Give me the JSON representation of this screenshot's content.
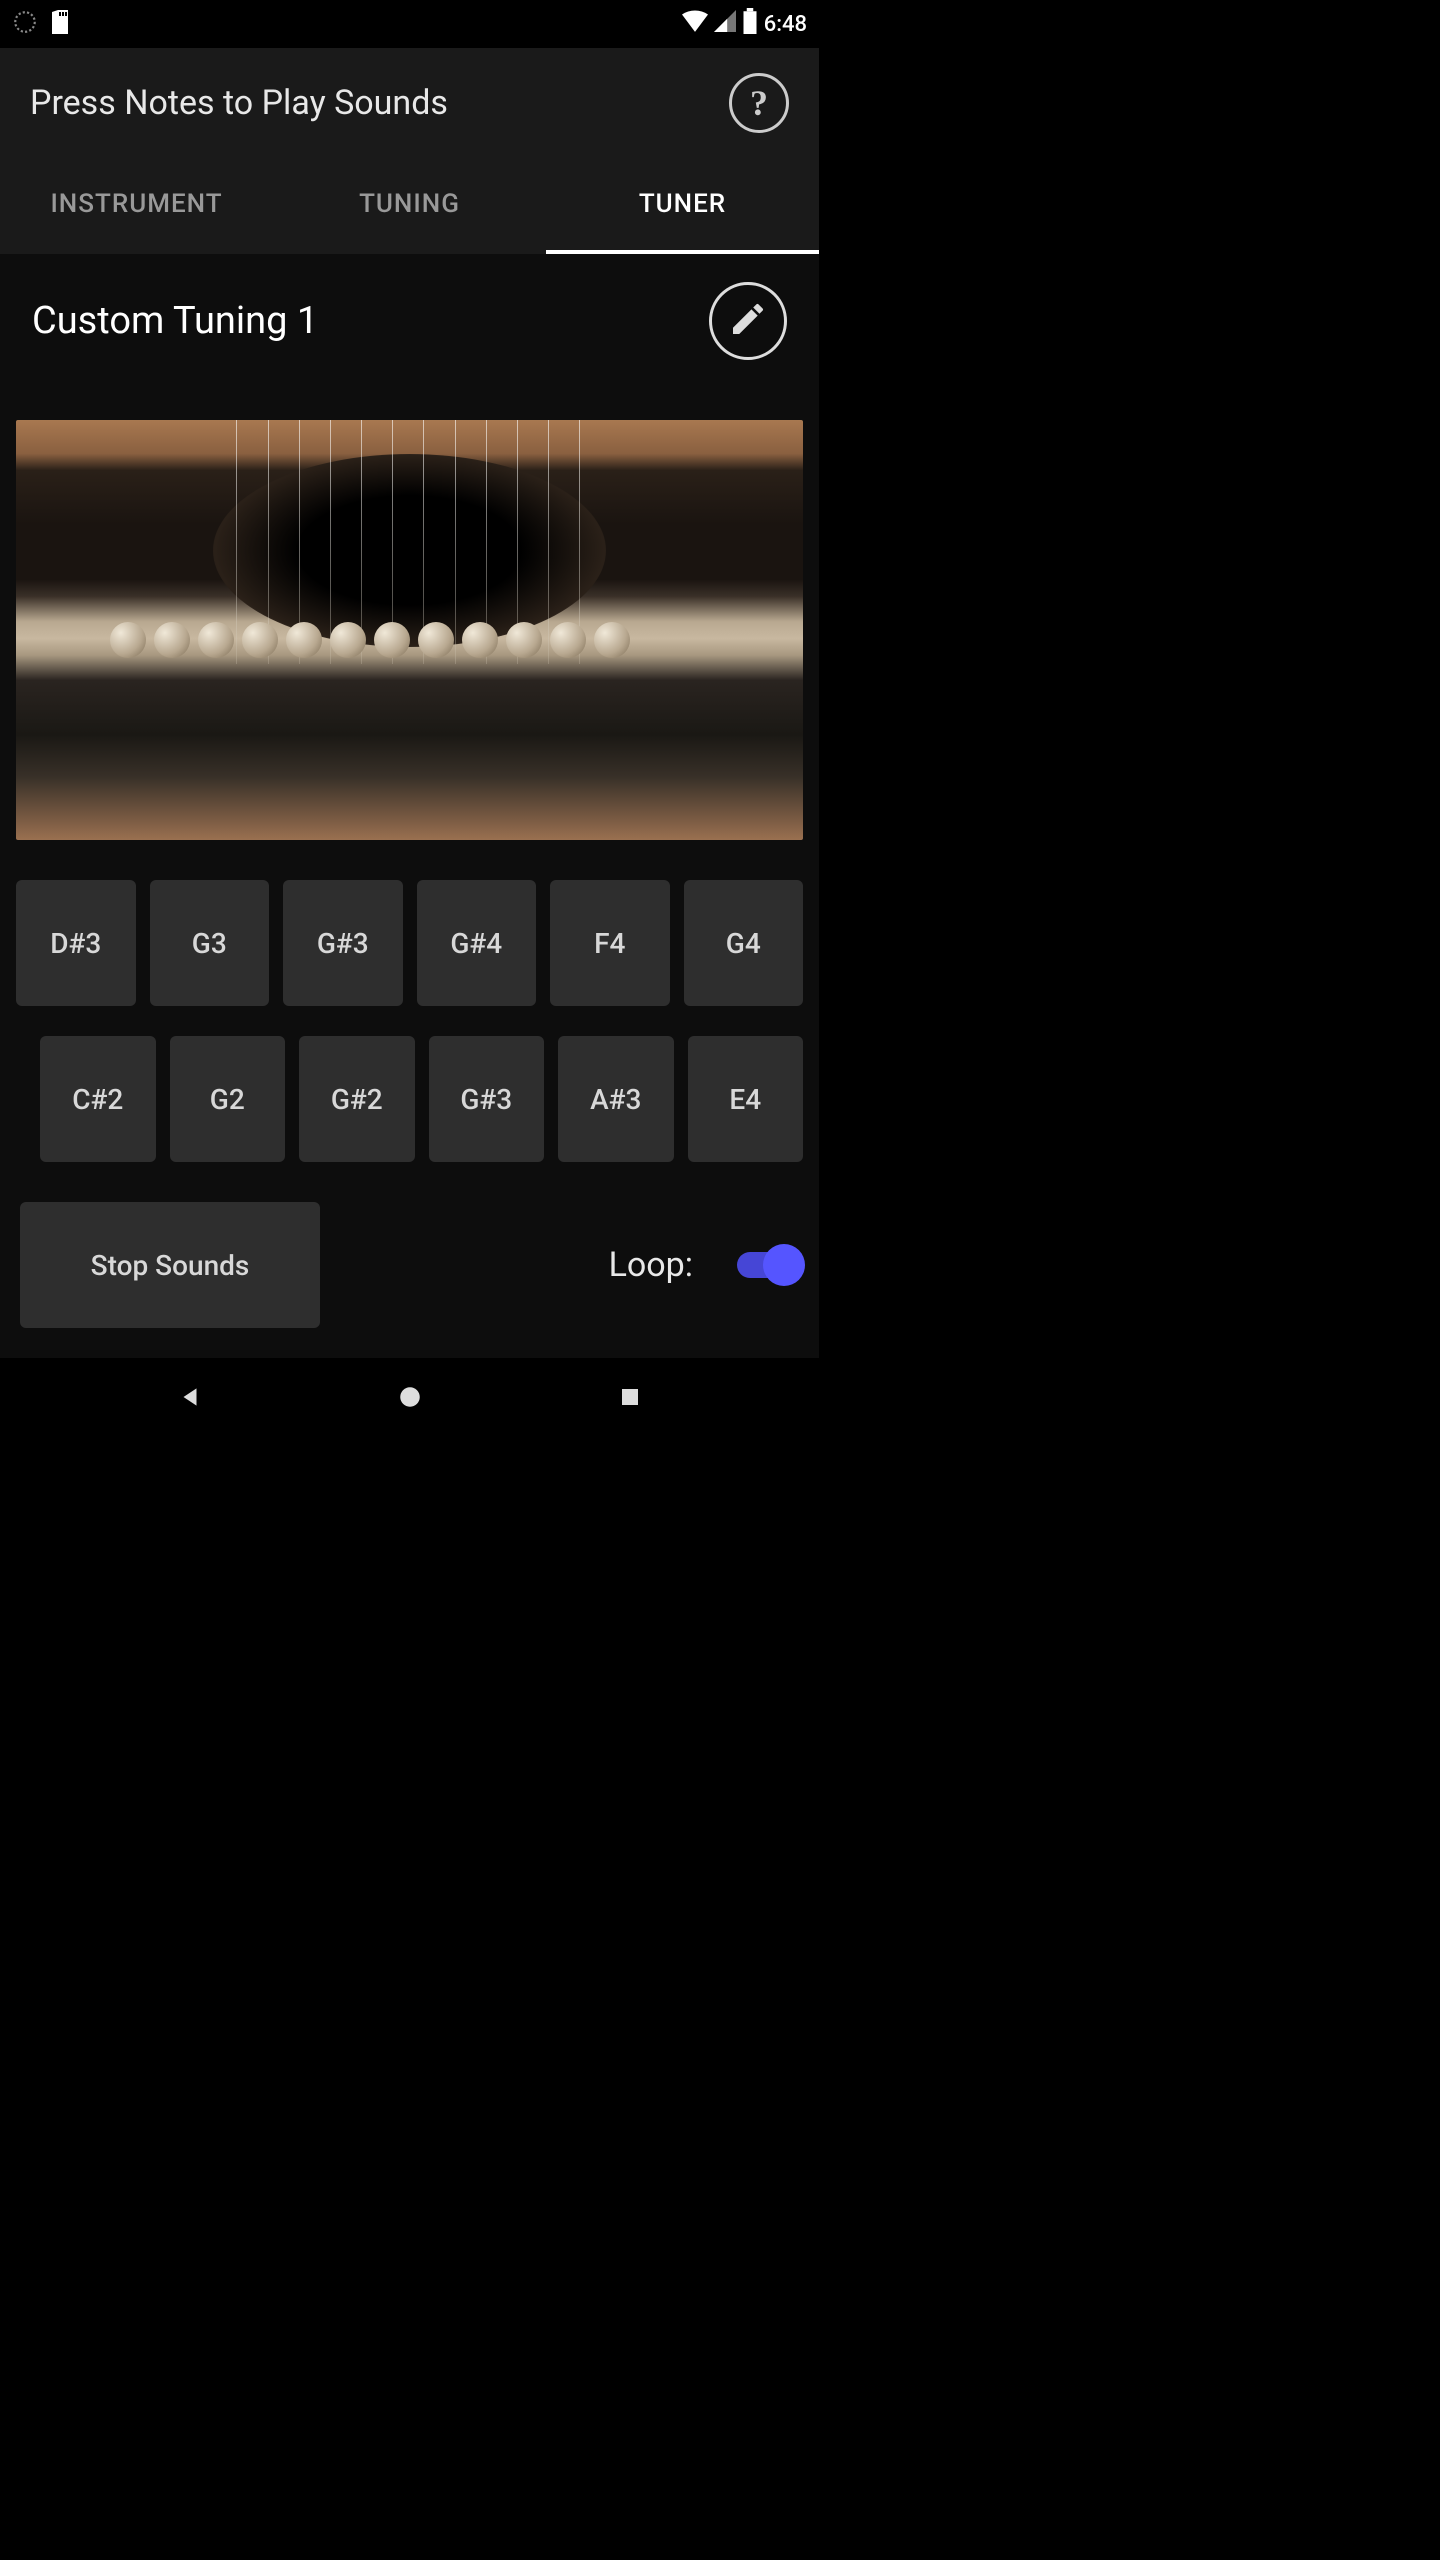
{
  "status": {
    "time": "6:48"
  },
  "header": {
    "title": "Press Notes to Play Sounds"
  },
  "tabs": [
    {
      "label": "INSTRUMENT",
      "active": false
    },
    {
      "label": "TUNING",
      "active": false
    },
    {
      "label": "TUNER",
      "active": true
    }
  ],
  "tuning": {
    "name": "Custom Tuning 1"
  },
  "notes": {
    "row1": [
      "D#3",
      "G3",
      "G#3",
      "G#4",
      "F4",
      "G4"
    ],
    "row2": [
      "C#2",
      "G2",
      "G#2",
      "G#3",
      "A#3",
      "E4"
    ]
  },
  "controls": {
    "stop_label": "Stop Sounds",
    "loop_label": "Loop:",
    "loop_on": true
  }
}
